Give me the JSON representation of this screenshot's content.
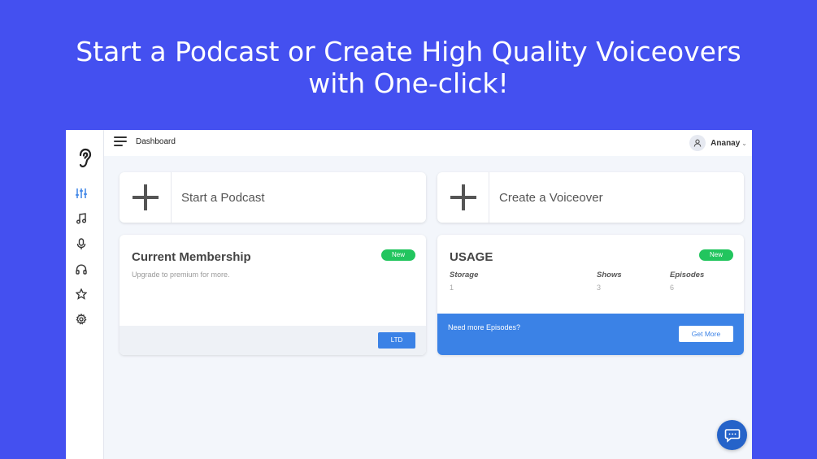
{
  "headline": {
    "line1": "Start a Podcast or Create High Quality Voiceovers",
    "line2": "with One-click!"
  },
  "colors": {
    "background": "#4450f0",
    "accent_blue": "#3b82e6",
    "badge_green": "#22c55e",
    "chat_button": "#2563c9"
  },
  "sidebar": {
    "logo": "ear-logo",
    "items": [
      {
        "icon": "sliders-icon",
        "active": true
      },
      {
        "icon": "music-note-icon"
      },
      {
        "icon": "microphone-icon"
      },
      {
        "icon": "headphones-icon"
      },
      {
        "icon": "star-icon"
      },
      {
        "icon": "gear-icon"
      }
    ]
  },
  "topbar": {
    "breadcrumb": "Dashboard",
    "user_name": "Ananay"
  },
  "actions": {
    "podcast_label": "Start a Podcast",
    "voiceover_label": "Create a Voiceover"
  },
  "membership": {
    "title": "Current Membership",
    "subtitle": "Upgrade to premium for more.",
    "badge": "New",
    "button": "LTD"
  },
  "usage": {
    "title": "USAGE",
    "badge": "New",
    "columns": [
      {
        "label": "Storage",
        "value": "1"
      },
      {
        "label": "Shows",
        "value": "3"
      },
      {
        "label": "Episodes",
        "value": "6"
      }
    ],
    "promo_text": "Need more Episodes?",
    "promo_button": "Get More"
  }
}
